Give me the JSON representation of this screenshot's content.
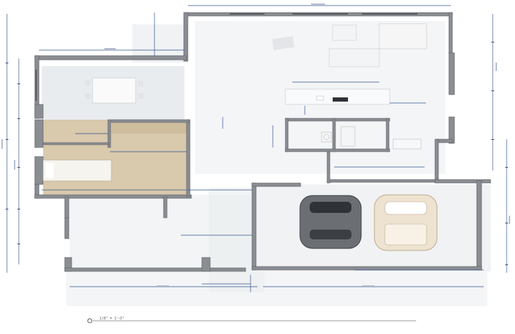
{
  "drawing": {
    "scale_label": "1/8\" = 1'-0\""
  },
  "colors": {
    "background": "#ffffff",
    "wall": "#8a8d92",
    "wall_dark": "#5d6066",
    "floor_shadow": "#eceff2",
    "bedroom_floor": "#d9c9ad",
    "garage_floor": "#f1f2f4",
    "dimension_line": "#2d4f8a",
    "car_gray": "#6b6f74",
    "car_cream": "#eee2d0"
  },
  "rooms": [
    {
      "id": "dining",
      "icon": "dining-table-icon"
    },
    {
      "id": "living",
      "icon": "sofa-icon"
    },
    {
      "id": "kitchen",
      "icon": "kitchen-island-icon"
    },
    {
      "id": "bedroom",
      "icon": "bed-icon"
    },
    {
      "id": "garage",
      "icon": "car-icon"
    },
    {
      "id": "laundry",
      "icon": "washer-icon"
    }
  ]
}
